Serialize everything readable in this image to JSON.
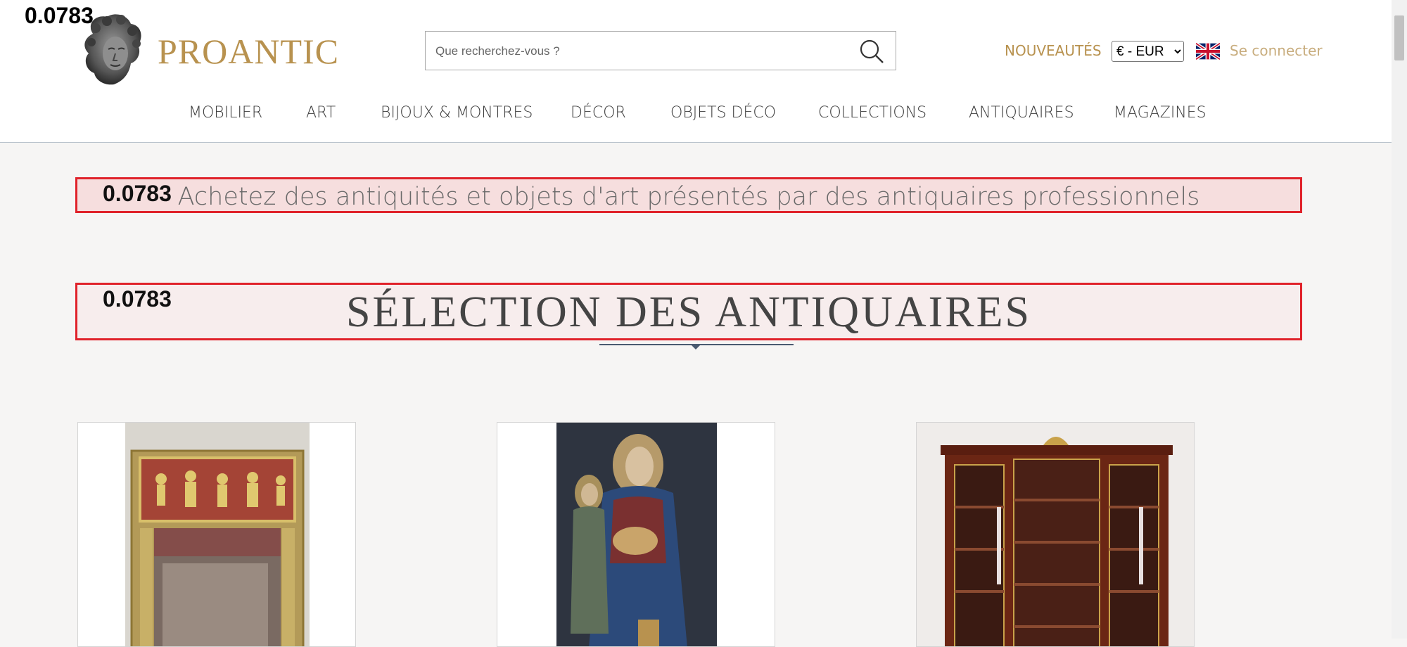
{
  "header": {
    "overlay_score": "0.0783",
    "logo_text": "PROANTIC",
    "search": {
      "placeholder": "Que recherchez-vous ?"
    },
    "nouveautes": "NOUVEAUTÉS",
    "currency": {
      "selected": "€ - EUR"
    },
    "language_icon": "uk-flag-icon",
    "connect": "Se connecter"
  },
  "nav": {
    "items": [
      {
        "label": "MOBILIER"
      },
      {
        "label": "ART"
      },
      {
        "label": "BIJOUX & MONTRES"
      },
      {
        "label": "DÉCOR"
      },
      {
        "label": "OBJETS DÉCO"
      },
      {
        "label": "COLLECTIONS"
      },
      {
        "label": "ANTIQUAIRES"
      },
      {
        "label": "MAGAZINES"
      }
    ]
  },
  "main": {
    "tagline": {
      "score": "0.0783",
      "text": "Achetez des antiquités et objets d'art présentés par des antiquaires professionnels"
    },
    "selection": {
      "score": "0.0783",
      "title": "SÉLECTION DES ANTIQUAIRES"
    },
    "cards": [
      {
        "image": "trumeau-mirror"
      },
      {
        "image": "polychrome-sculpture"
      },
      {
        "image": "mahogany-bookcase"
      }
    ]
  },
  "colors": {
    "brand_gold": "#b8924f",
    "highlight_border": "#e0222a",
    "page_bg": "#f6f5f4"
  }
}
